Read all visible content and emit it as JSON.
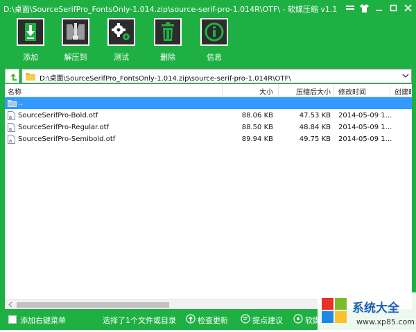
{
  "window": {
    "title": "D:\\桌面\\SourceSerifPro_FontsOnly-1.014.zip\\source-serif-pro-1.014R\\OTF\\ - 软媒压缩 v1.1",
    "colors": {
      "frame": "#1fb043",
      "selection": "#3399ff",
      "tool_icon_bg": "#2c2c2c"
    },
    "controls": [
      "menu-icon",
      "shirt-icon",
      "minimize-icon",
      "maximize-icon",
      "close-icon"
    ]
  },
  "toolbar": {
    "buttons": [
      {
        "label": "添加",
        "icon": "add-archive-icon"
      },
      {
        "label": "解压到",
        "icon": "zip-extract-icon"
      },
      {
        "label": "测试",
        "icon": "gears-icon"
      },
      {
        "label": "删除",
        "icon": "trash-icon"
      },
      {
        "label": "信息",
        "icon": "info-icon"
      }
    ]
  },
  "pathbar": {
    "path": "D:\\桌面\\SourceSerifPro_FontsOnly-1.014.zip\\source-serif-pro-1.014R\\OTF\\"
  },
  "filelist": {
    "columns": [
      "名称",
      "大小",
      "压缩后大小",
      "修改时间",
      "创建时"
    ],
    "parent": "..",
    "rows": [
      {
        "name": "SourceSerifPro-Bold.otf",
        "size": "88.06 KB",
        "compressed": "47.53 KB",
        "modified": "2014-05-09 1..."
      },
      {
        "name": "SourceSerifPro-Regular.otf",
        "size": "88.50 KB",
        "compressed": "48.84 KB",
        "modified": "2014-05-09 1..."
      },
      {
        "name": "SourceSerifPro-Semibold.otf",
        "size": "89.94 KB",
        "compressed": "49.75 KB",
        "modified": "2014-05-09 1..."
      }
    ]
  },
  "statusbar": {
    "context_menu": "添加右键菜单",
    "selection": "选择了1个文件或目录",
    "check_update": "检查更新",
    "feedback": "提点建议",
    "software_cut": "软媒"
  },
  "watermark": {
    "brand": "系统大全",
    "site": "www.xp85.com"
  }
}
